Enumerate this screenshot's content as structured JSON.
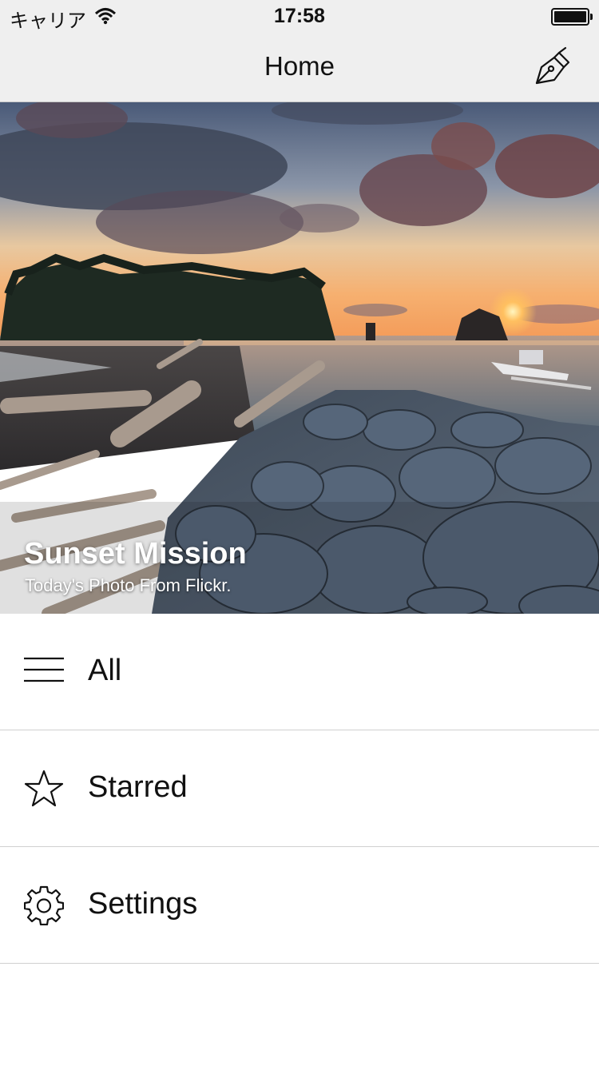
{
  "status_bar": {
    "carrier": "キャリア",
    "time": "17:58",
    "wifi_icon": "wifi-icon",
    "battery_icon": "battery-icon"
  },
  "nav": {
    "title": "Home",
    "compose_icon": "pen-nib-icon"
  },
  "hero": {
    "title": "Sunset Mission",
    "subtitle": "Today's Photo From Flickr."
  },
  "menu": {
    "items": [
      {
        "label": "All",
        "icon": "list-icon"
      },
      {
        "label": "Starred",
        "icon": "star-icon"
      },
      {
        "label": "Settings",
        "icon": "gear-icon"
      }
    ]
  },
  "colors": {
    "bar_background": "#efefef",
    "separator": "#d0d0d0",
    "text": "#111111"
  }
}
